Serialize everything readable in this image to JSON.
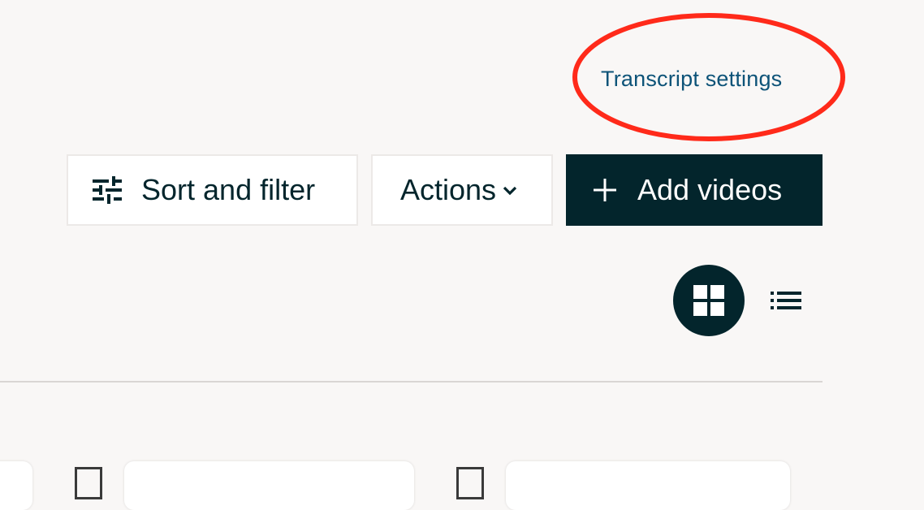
{
  "header": {
    "transcript_settings_label": "Transcript settings"
  },
  "toolbar": {
    "sort_filter_label": "Sort and filter",
    "actions_label": "Actions",
    "add_videos_label": "Add videos"
  },
  "view_toggle": {
    "grid_selected": true
  },
  "colors": {
    "primary": "#03252c",
    "link": "#0d5378",
    "highlight": "#ff2a1a",
    "background": "#f9f7f6"
  },
  "icons": {
    "sort": "sliders-icon",
    "actions": "chevron-down-icon",
    "add": "plus-icon",
    "grid": "grid-view-icon",
    "list": "list-view-icon"
  }
}
